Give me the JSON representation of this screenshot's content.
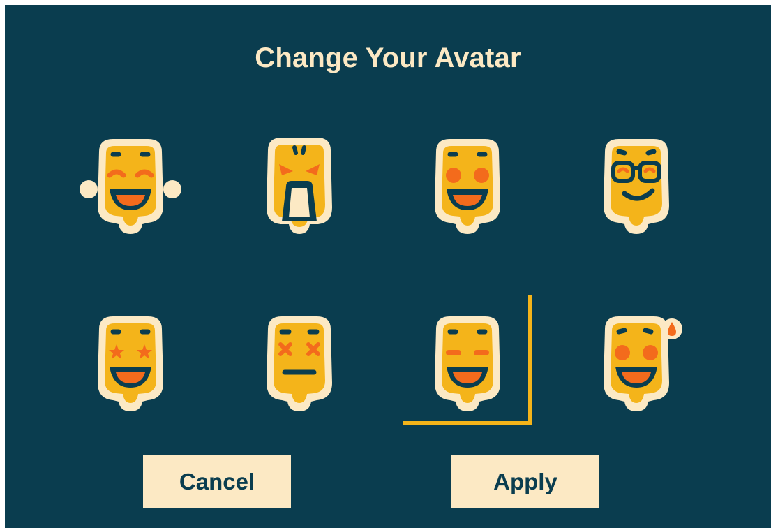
{
  "dialog": {
    "title": "Change Your Avatar",
    "cancel_label": "Cancel",
    "apply_label": "Apply"
  },
  "avatars": [
    {
      "id": "laughing",
      "icon": "laughing-face-icon"
    },
    {
      "id": "angry",
      "icon": "angry-face-icon"
    },
    {
      "id": "happy-blush",
      "icon": "happy-blushing-face-icon"
    },
    {
      "id": "cool",
      "icon": "smirking-glasses-face-icon"
    },
    {
      "id": "star-eyes",
      "icon": "star-eyes-face-icon"
    },
    {
      "id": "dizzy",
      "icon": "dizzy-face-icon"
    },
    {
      "id": "content",
      "icon": "content-smiling-face-icon",
      "selected": true
    },
    {
      "id": "sweat",
      "icon": "sweat-smile-face-icon"
    }
  ],
  "colors": {
    "background": "#0a3d4f",
    "face": "#f4b41a",
    "outline": "#fce9c4",
    "accent": "#f36b1c",
    "selection": "#f4b41a"
  }
}
